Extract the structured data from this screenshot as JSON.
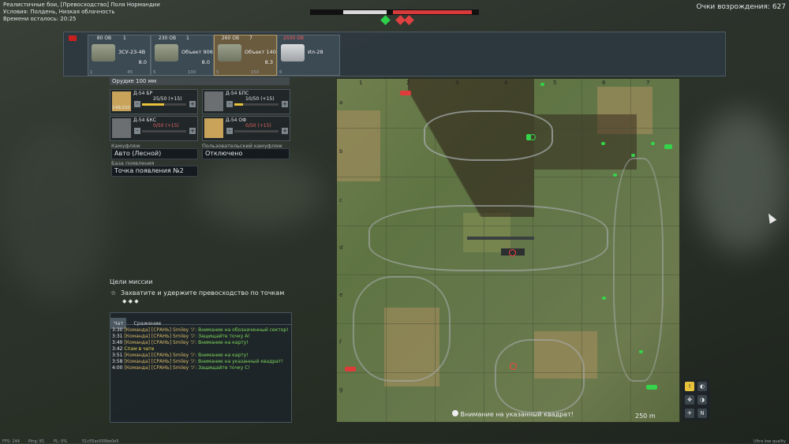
{
  "top_info": {
    "mode": "Реалистичные бои, [Превосходство] Поля Нормандии",
    "conditions": "Условия: Полдень, Низкая облачность",
    "time_left": "Времени осталось: 20:25"
  },
  "respawn_points": "Очки возрождения: 627",
  "score": {
    "team_bar": 0.45,
    "enemy_bar": 0.8
  },
  "zones": [
    {
      "color": "#2fcf4a"
    },
    {
      "color": "#e04040"
    },
    {
      "color": "#e04040"
    }
  ],
  "slots": [
    {
      "cost": "80 ОВ",
      "crew": "1",
      "name": "ЗСУ-23-4В",
      "br": "8.0",
      "foot_l": "1",
      "foot_r": "45",
      "cost_red": false,
      "selected": false
    },
    {
      "cost": "230 ОВ",
      "crew": "1",
      "name": "Объект 906",
      "br": "8.0",
      "foot_l": "5",
      "foot_r": "100",
      "cost_red": false,
      "selected": false
    },
    {
      "cost": "260 ОВ",
      "crew": "7",
      "name": "Объект 140",
      "br": "8.3",
      "foot_l": "5",
      "foot_r": "150",
      "cost_red": false,
      "selected": true
    },
    {
      "cost": "2500 ОВ",
      "crew": "",
      "name": "Ил-28",
      "br": "",
      "foot_l": "6",
      "foot_r": "",
      "cost_red": true,
      "selected": false
    }
  ],
  "weapon": {
    "header": "Орудие 100 мм",
    "shells": [
      {
        "name": "Д-54 БР",
        "count": "25/50 (+15)",
        "total": "148/150",
        "fill": 0.5
      },
      {
        "name": "Д-54 БПС",
        "count": "10/50 (+15)",
        "total": "",
        "fill": 0.2
      },
      {
        "name": "Д-54 БКС",
        "count": "0/50 (+15)",
        "total": "",
        "fill": 0.0
      },
      {
        "name": "Д-54 ОФ",
        "count": "0/50 (+15)",
        "total": "",
        "fill": 0.0
      }
    ],
    "camo_label": "Камуфляж",
    "camo_value": "Авто (Лесной)",
    "user_camo_label": "Пользовательский камуфляж",
    "user_camo_value": "Отключено",
    "spawn_label": "База появления",
    "spawn_value": "Точка появления №2"
  },
  "mission": {
    "header": "Цели миссии",
    "objective": "Захватите и удержите превосходство по точкам"
  },
  "chat": {
    "tabs": [
      "Чат",
      "Сражение"
    ],
    "messages": [
      {
        "time": "3:30",
        "sender": "[Команда] [СРАНЬ] Smiley ツ:",
        "text": "Внимание на обозначенный сектор!",
        "style": "g"
      },
      {
        "time": "3:31",
        "sender": "[Команда] [СРАНЬ] Smiley ツ:",
        "text": "Защищайте точку A!",
        "style": "g"
      },
      {
        "time": "3:40",
        "sender": "[Команда] [СРАНЬ] Smiley ツ:",
        "text": "Внимание на карту!",
        "style": "g"
      },
      {
        "time": "3:42",
        "sender": "",
        "text": "Спам в чате",
        "style": "y"
      },
      {
        "time": "3:51",
        "sender": "[Команда] [СРАНЬ] Smiley ツ:",
        "text": "Внимание на карту!",
        "style": "g"
      },
      {
        "time": "3:58",
        "sender": "[Команда] [СРАНЬ] Smiley ツ:",
        "text": "Внимание на указанный квадрат!",
        "style": "g"
      },
      {
        "time": "4:00",
        "sender": "[Команда] [СРАНЬ] Smiley ツ:",
        "text": "Защищайте точку C!",
        "style": "g"
      }
    ]
  },
  "map": {
    "columns": [
      "1",
      "2",
      "3",
      "4",
      "5",
      "6",
      "7"
    ],
    "rows": [
      "a",
      "b",
      "c",
      "d",
      "e",
      "f",
      "g"
    ],
    "note": "Внимание на указанный квадрат!",
    "scale": "250 m",
    "north": "N"
  },
  "footer": {
    "fps": "FPS: 144",
    "ping": "Ping: 81",
    "pl": "PL: 0%",
    "session": "51c55ac000be0e5",
    "quality": "Ultra low quality"
  }
}
